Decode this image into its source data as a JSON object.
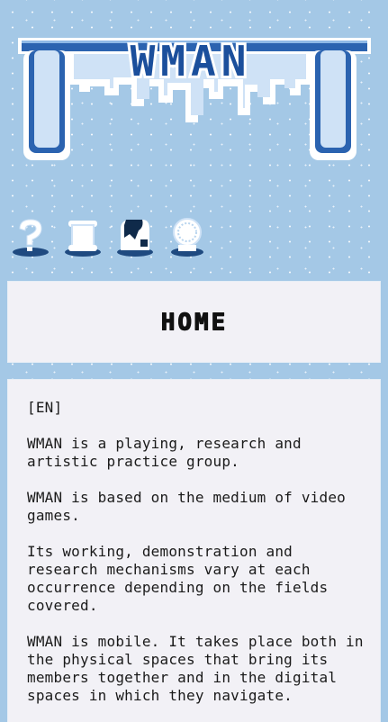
{
  "logo": {
    "text": "WMAN"
  },
  "nav": {
    "items": [
      {
        "id": "about",
        "icon": "question-mark-icon"
      },
      {
        "id": "scroll",
        "icon": "scroll-icon"
      },
      {
        "id": "home",
        "icon": "cow-icon"
      },
      {
        "id": "globe",
        "icon": "crystal-ball-icon"
      }
    ]
  },
  "page": {
    "title": "HOME"
  },
  "content": {
    "lang_tag": "[EN]",
    "paragraphs": [
      "WMAN is a playing, research and artistic practice group.",
      "WMAN is based on the medium of video games.",
      "Its working, demonstration and research mechanisms vary at each occurrence depending on the fields covered.",
      "WMAN is mobile. It takes place both in the physical spaces that bring its members together and in the digital spaces in which they navigate."
    ]
  },
  "colors": {
    "background": "#a4c8e6",
    "panel": "#f2f1f6",
    "ice_dark": "#1b4f9c",
    "ice_light": "#ffffff"
  }
}
